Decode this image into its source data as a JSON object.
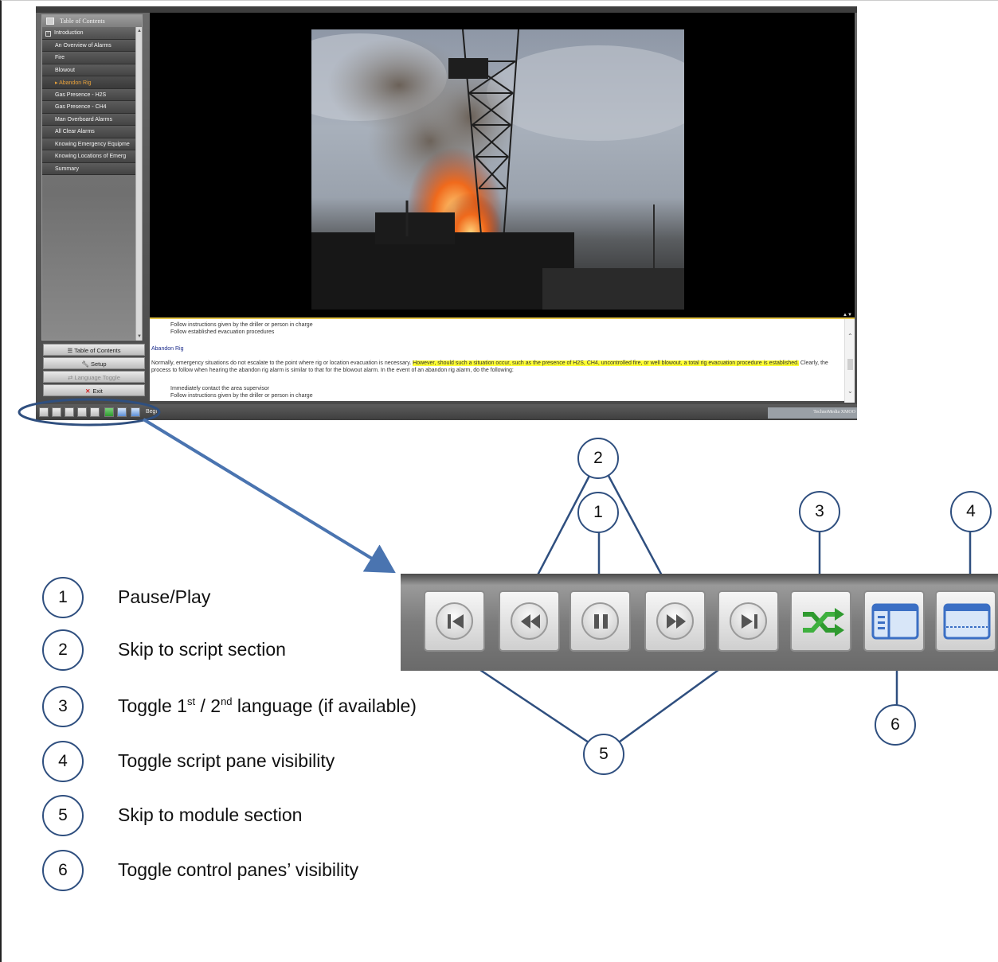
{
  "toc": {
    "header": "Table of Contents",
    "items": [
      {
        "label": "Introduction"
      },
      {
        "label": "An Overview of Alarms"
      },
      {
        "label": "Fire"
      },
      {
        "label": "Blowout"
      },
      {
        "label": "Abandon Rig"
      },
      {
        "label": "Gas Presence - H2S"
      },
      {
        "label": "Gas Presence - CH4"
      },
      {
        "label": "Man Overboard Alarms"
      },
      {
        "label": "All Clear Alarms"
      },
      {
        "label": "Knowing Emergency Equipme"
      },
      {
        "label": "Knowing Locations of Emerg"
      },
      {
        "label": "Summary"
      }
    ],
    "active_item": "Abandon Rig"
  },
  "side_buttons": {
    "toc": "Table of Contents",
    "setup": "Setup",
    "language": "Language Toggle",
    "exit": "Exit"
  },
  "script": {
    "line1": "Follow instructions given by the driller or person in charge",
    "line2": "Follow established evacuation procedures",
    "heading": "Abandon Rig",
    "para_start": "Normally, emergency situations do not escalate to the point where rig or location evacuation is necessary. ",
    "para_highlight": "However, should such a situation occur, such as the presence of H2S, CH4, uncontrolled fire, or well blowout, a total rig evacuation procedure is established.",
    "para_end": " Clearly, the process to follow when hearing the abandon rig alarm is similar to that for the blowout alarm. In the event of an abandon rig alarm, do the following:",
    "line3": "Immediately contact the area supervisor",
    "line4": "Follow instructions given by the driller or person in charge"
  },
  "bottom_bar": {
    "label": "Begi",
    "brand": "TechnoMedia XMOO"
  },
  "callouts": {
    "c1": "1",
    "c2": "2",
    "c3": "3",
    "c4": "4",
    "c5": "5",
    "c6": "6"
  },
  "legend": [
    {
      "num": "1",
      "text": "Pause/Play"
    },
    {
      "num": "2",
      "text": "Skip to script section"
    },
    {
      "num": "3",
      "pre": "Toggle 1",
      "sup1": "st",
      "mid": " / 2",
      "sup2": "nd",
      "post": " language (if available)"
    },
    {
      "num": "4",
      "text": "Toggle script pane visibility"
    },
    {
      "num": "5",
      "text": "Skip to module section"
    },
    {
      "num": "6",
      "text": "Toggle control panes’ visibility"
    }
  ],
  "colors": {
    "accent_blue": "#2f4f7f",
    "arrow_blue": "#4a74b0",
    "highlight": "#ffff33",
    "active_toc": "#e9a23b"
  },
  "icons": [
    "first-section-icon",
    "rewind-icon",
    "pause-icon",
    "fast-forward-icon",
    "last-section-icon",
    "language-shuffle-icon",
    "control-panes-icon",
    "script-pane-icon",
    "fire-rig-photo"
  ]
}
